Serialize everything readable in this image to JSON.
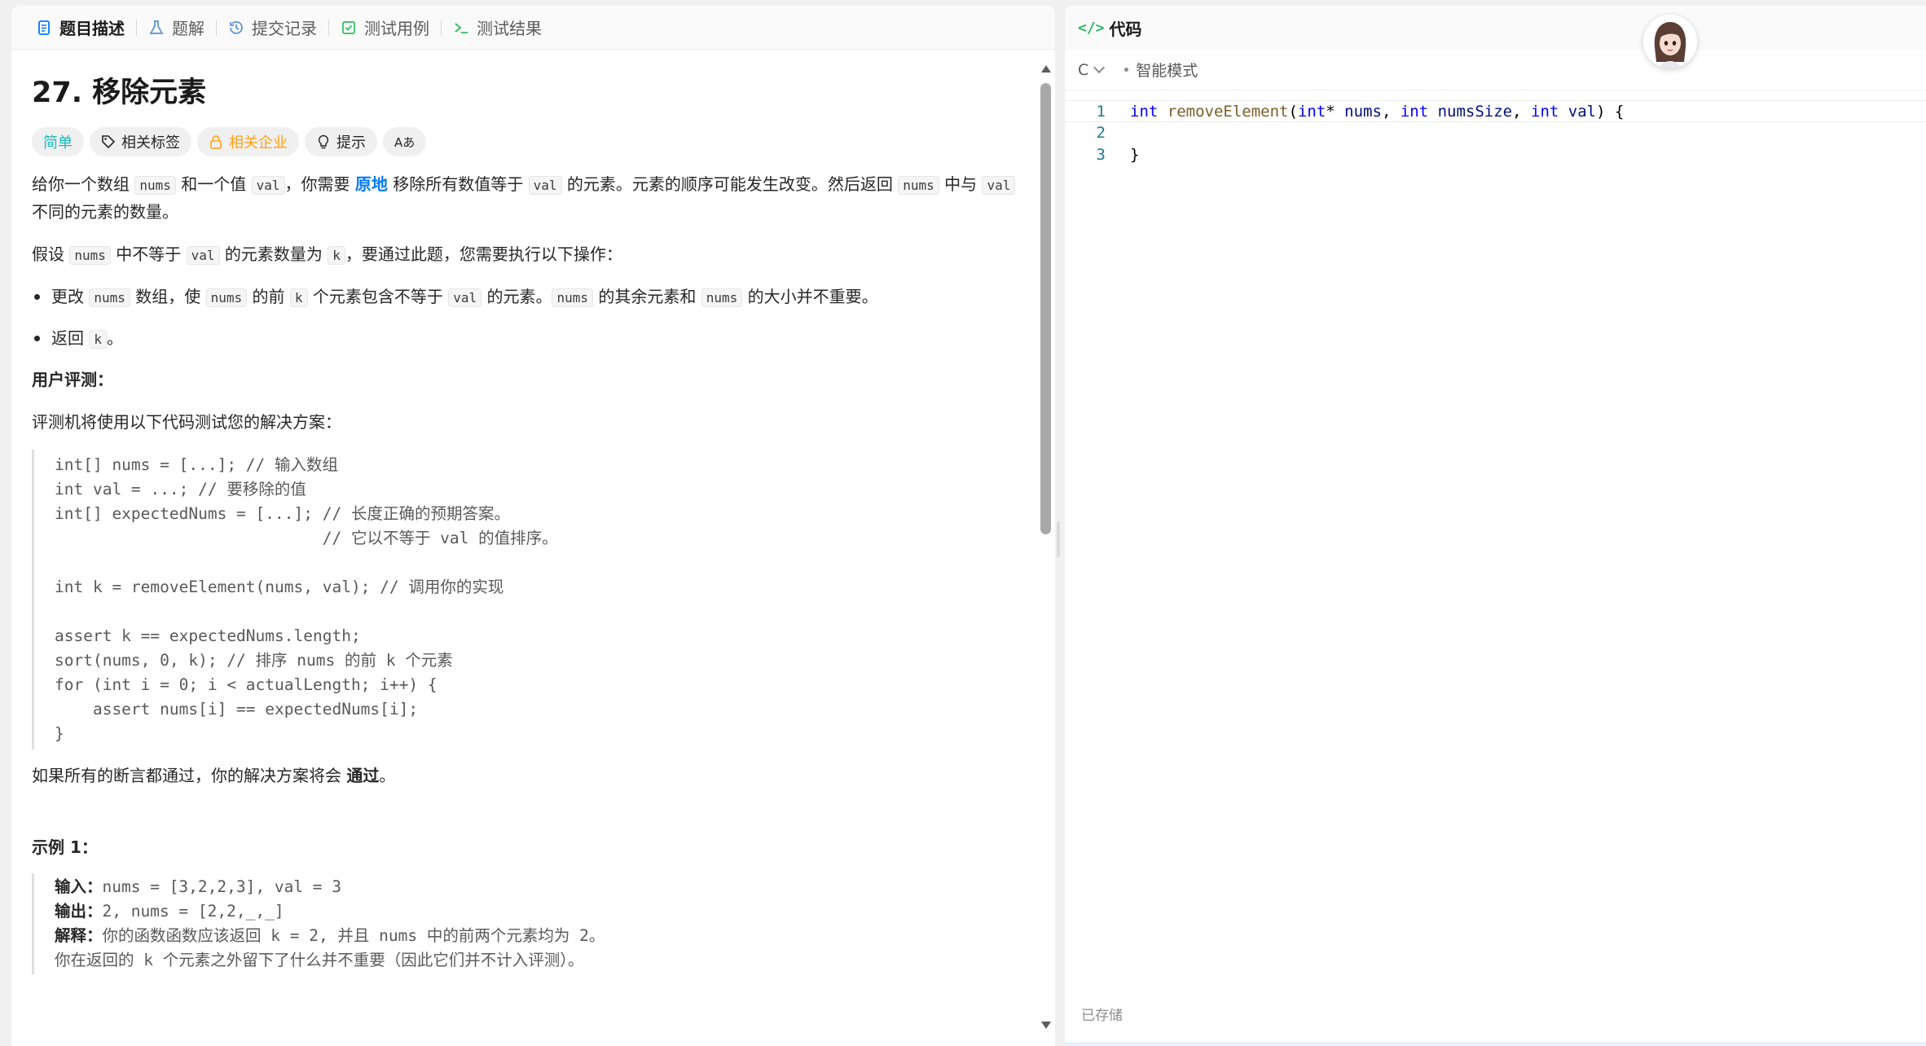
{
  "tabs": [
    {
      "label": "题目描述",
      "icon": "description-icon",
      "active": true
    },
    {
      "label": "题解",
      "icon": "flask-icon",
      "active": false
    },
    {
      "label": "提交记录",
      "icon": "history-icon",
      "active": false
    },
    {
      "label": "测试用例",
      "icon": "checkbox-icon",
      "active": false
    },
    {
      "label": "测试结果",
      "icon": "terminal-icon",
      "active": false
    }
  ],
  "problem": {
    "title": "27. 移除元素",
    "tags": {
      "difficulty": "简单",
      "related_tags": "相关标签",
      "companies": "相关企业",
      "hint": "提示",
      "translate_icon": "Aあ"
    },
    "desc": {
      "t1": "给你一个数组 ",
      "c_nums": "nums",
      "t2": " 和一个值 ",
      "c_val": "val",
      "t3": "，你需要 ",
      "inplace": "原地",
      "t4": " 移除所有数值等于 ",
      "t5": " 的元素。元素的顺序可能发生改变。然后返回 ",
      "t6": " 中与 ",
      "t7": " 不同的元素的数量。"
    },
    "assume": {
      "t1": "假设 ",
      "t2": " 中不等于 ",
      "t3": " 的元素数量为 ",
      "c_k": "k",
      "t4": "，要通过此题，您需要执行以下操作："
    },
    "bullet1": {
      "t1": "更改 ",
      "t2": " 数组，使 ",
      "t3": " 的前 ",
      "t4": " 个元素包含不等于 ",
      "t5": " 的元素。",
      "t6": " 的其余元素和 ",
      "t7": " 的大小并不重要。"
    },
    "bullet2": {
      "t1": "返回 ",
      "t2": "。"
    },
    "judge_heading": "用户评测：",
    "judge_intro": "评测机将使用以下代码测试您的解决方案：",
    "judge_code": "int[] nums = [...]; // 输入数组\nint val = ...; // 要移除的值\nint[] expectedNums = [...]; // 长度正确的预期答案。\n                            // 它以不等于 val 的值排序。\n\nint k = removeElement(nums, val); // 调用你的实现\n\nassert k == expectedNums.length;\nsort(nums, 0, k); // 排序 nums 的前 k 个元素\nfor (int i = 0; i < actualLength; i++) {\n    assert nums[i] == expectedNums[i];\n}",
    "pass_t1": "如果所有的断言都通过，你的解决方案将会 ",
    "pass_strong": "通过",
    "pass_t2": "。",
    "example1": {
      "heading": "示例 1：",
      "input_label": "输入：",
      "input": "nums = [3,2,2,3], val = 3",
      "output_label": "输出：",
      "output": "2, nums = [2,2,_,_]",
      "explain_label": "解释：",
      "explain": "你的函数函数应该返回 k = 2, 并且 nums 中的前两个元素均为 2。",
      "explain2": "你在返回的 k 个元素之外留下了什么并不重要（因此它们并不计入评测）。"
    }
  },
  "editor": {
    "header_label": "代码",
    "language": "C",
    "mode": "智能模式",
    "line_numbers": [
      "1",
      "2",
      "3"
    ],
    "code": {
      "l1_kw1": "int",
      "l1_fn": "removeElement",
      "l1_p1": "(",
      "l1_kw2": "int",
      "l1_p2": "* ",
      "l1_v1": "nums",
      "l1_p3": ", ",
      "l1_kw3": "int",
      "l1_v2": "numsSize",
      "l1_p4": ", ",
      "l1_kw4": "int",
      "l1_v3": "val",
      "l1_p5": ") {",
      "l3": "}"
    },
    "saved": "已存储"
  },
  "colors": {
    "easy": "#1cb8b8",
    "company": "#ffa116",
    "link": "#007aff",
    "code_icon": "#2cbb5d"
  }
}
